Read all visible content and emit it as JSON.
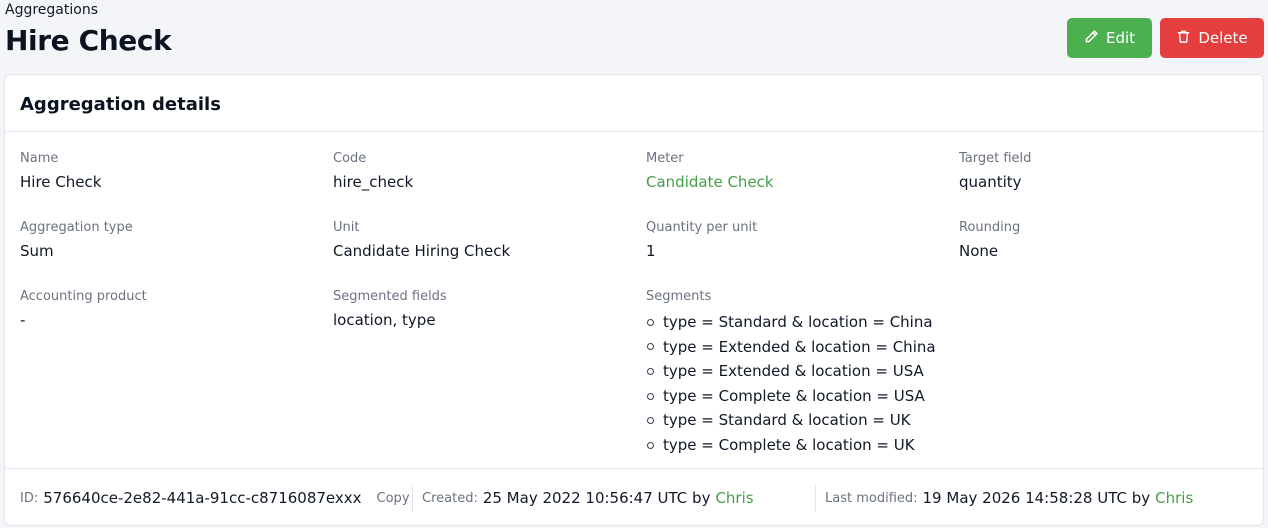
{
  "header": {
    "breadcrumb": "Aggregations",
    "title": "Hire Check",
    "edit_label": "Edit",
    "delete_label": "Delete"
  },
  "card": {
    "title": "Aggregation details",
    "fields": {
      "name": {
        "label": "Name",
        "value": "Hire Check"
      },
      "code": {
        "label": "Code",
        "value": "hire_check"
      },
      "meter": {
        "label": "Meter",
        "value": "Candidate Check"
      },
      "target_field": {
        "label": "Target field",
        "value": "quantity"
      },
      "aggregation_type": {
        "label": "Aggregation type",
        "value": "Sum"
      },
      "unit": {
        "label": "Unit",
        "value": "Candidate Hiring Check"
      },
      "quantity_per_unit": {
        "label": "Quantity per unit",
        "value": "1"
      },
      "rounding": {
        "label": "Rounding",
        "value": "None"
      },
      "accounting_product": {
        "label": "Accounting product",
        "value": "-"
      },
      "segmented_fields": {
        "label": "Segmented fields",
        "value": "location, type"
      },
      "segments": {
        "label": "Segments",
        "items": [
          "type = Standard & location = China",
          "type = Extended & location = China",
          "type = Extended & location = USA",
          "type = Complete & location = USA",
          "type = Standard & location = UK",
          "type = Complete & location = UK"
        ]
      }
    },
    "footer": {
      "id_label": "ID:",
      "id_value": "576640ce-2e82-441a-91cc-c8716087exxx",
      "copy_label": "Copy",
      "created_label": "Created:",
      "created_value": "25 May 2022 10:56:47 UTC by",
      "created_by": "Chris",
      "modified_label": "Last modified:",
      "modified_value": "19 May 2026 14:58:28 UTC by",
      "modified_by": "Chris"
    }
  },
  "colors": {
    "edit_button": "#4caf50",
    "delete_button": "#e53e3e",
    "link": "#43a047"
  }
}
